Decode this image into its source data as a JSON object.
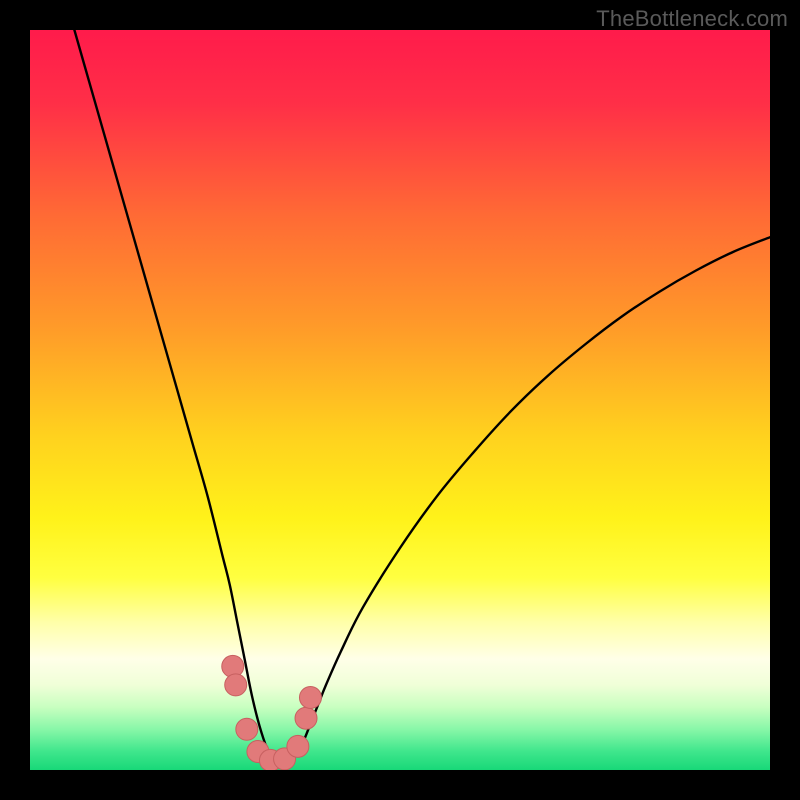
{
  "watermark": "TheBottleneck.com",
  "colors": {
    "frame": "#000000",
    "curve": "#000000",
    "marker_fill": "#e17a7a",
    "marker_stroke": "#c76060",
    "gradient_stops": [
      {
        "offset": 0.0,
        "color": "#ff1b4b"
      },
      {
        "offset": 0.1,
        "color": "#ff2f47"
      },
      {
        "offset": 0.25,
        "color": "#ff6a35"
      },
      {
        "offset": 0.4,
        "color": "#ff9a29"
      },
      {
        "offset": 0.55,
        "color": "#ffd21e"
      },
      {
        "offset": 0.66,
        "color": "#fff21a"
      },
      {
        "offset": 0.74,
        "color": "#ffff40"
      },
      {
        "offset": 0.8,
        "color": "#ffffa8"
      },
      {
        "offset": 0.85,
        "color": "#ffffe8"
      },
      {
        "offset": 0.885,
        "color": "#f0ffd8"
      },
      {
        "offset": 0.915,
        "color": "#c8ffc0"
      },
      {
        "offset": 0.945,
        "color": "#88f7a8"
      },
      {
        "offset": 0.975,
        "color": "#3fe68c"
      },
      {
        "offset": 1.0,
        "color": "#18d878"
      }
    ]
  },
  "chart_data": {
    "type": "line",
    "title": "",
    "xlabel": "",
    "ylabel": "",
    "xlim": [
      0,
      100
    ],
    "ylim": [
      0,
      100
    ],
    "note": "Axes are unlabeled in the source image; x and y are in percent of plot width/height. y=0 at the bottom (green), y=100 at the top (red). Curve is a V-shaped bottleneck profile with minimum near x≈33.",
    "series": [
      {
        "name": "bottleneck-curve",
        "x": [
          6,
          8,
          10,
          12,
          14,
          16,
          18,
          20,
          22,
          24,
          26,
          27,
          28,
          29,
          30,
          31,
          32,
          33,
          34,
          35,
          36,
          37,
          38,
          39,
          40,
          42,
          45,
          50,
          55,
          60,
          65,
          70,
          75,
          80,
          85,
          90,
          95,
          100
        ],
        "y": [
          100,
          93,
          86,
          79,
          72,
          65,
          58,
          51,
          44,
          37,
          29,
          25,
          20,
          15,
          10,
          6,
          3,
          1.2,
          1.0,
          1.2,
          2.2,
          4.0,
          6.5,
          9.0,
          11.5,
          16,
          22,
          30,
          37,
          43,
          48.5,
          53.3,
          57.5,
          61.3,
          64.6,
          67.5,
          70,
          72
        ]
      }
    ],
    "markers": {
      "name": "highlighted-points",
      "x": [
        27.4,
        27.8,
        29.3,
        30.8,
        32.5,
        34.4,
        36.2,
        37.3,
        37.9
      ],
      "y": [
        14.0,
        11.5,
        5.5,
        2.5,
        1.3,
        1.5,
        3.2,
        7.0,
        9.8
      ]
    }
  }
}
